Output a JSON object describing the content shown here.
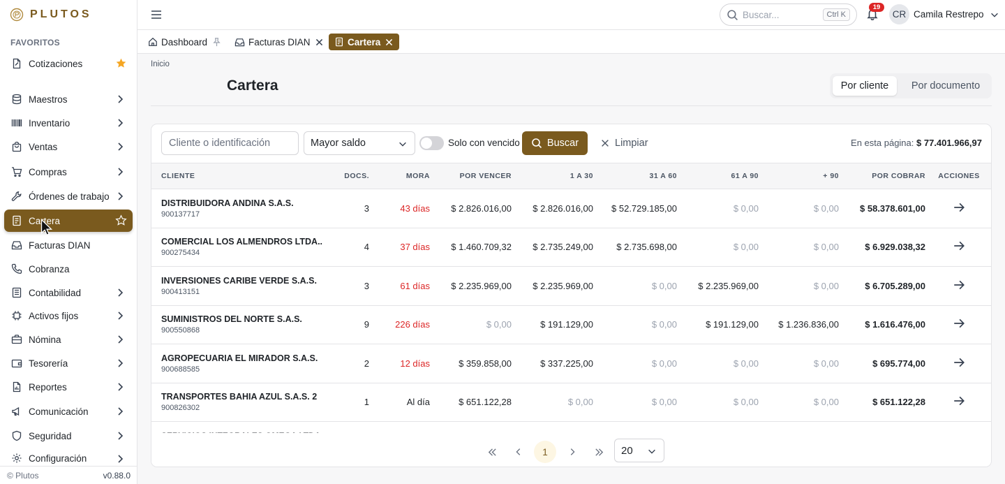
{
  "brand": {
    "name": "PLUTOS"
  },
  "sidebar": {
    "favorites_title": "FAVORITOS",
    "favorite": {
      "label": "Cotizaciones"
    },
    "items": [
      {
        "label": "Maestros"
      },
      {
        "label": "Inventario"
      },
      {
        "label": "Ventas"
      },
      {
        "label": "Compras"
      },
      {
        "label": "Órdenes de trabajo"
      },
      {
        "label": "Cartera"
      },
      {
        "label": "Facturas DIAN"
      },
      {
        "label": "Cobranza"
      },
      {
        "label": "Contabilidad"
      },
      {
        "label": "Activos fijos"
      },
      {
        "label": "Nómina"
      },
      {
        "label": "Tesorería"
      },
      {
        "label": "Reportes"
      },
      {
        "label": "Comunicación"
      },
      {
        "label": "Seguridad"
      },
      {
        "label": "Configuración"
      }
    ],
    "footer": {
      "copyright": "© Plutos",
      "version": "v0.88.0"
    }
  },
  "topbar": {
    "search_placeholder": "Buscar...",
    "search_shortcut": "Ctrl K",
    "notifications_count": "19",
    "user_initials": "CR",
    "user_name": "Camila Restrepo"
  },
  "tabs": [
    {
      "label": "Dashboard"
    },
    {
      "label": "Facturas DIAN"
    },
    {
      "label": "Cartera"
    }
  ],
  "page": {
    "breadcrumb": "Inicio",
    "title": "Cartera",
    "view_toggle": {
      "by_client": "Por cliente",
      "by_document": "Por documento"
    }
  },
  "filters": {
    "client_placeholder": "Cliente o identificación",
    "sort_value": "Mayor saldo",
    "overdue_toggle_label": "Solo con vencido",
    "overdue_toggle_on": false,
    "search_button": "Buscar",
    "clear_button": "Limpiar",
    "page_total_label": "En esta página:",
    "page_total_value": "$ 77.401.966,97"
  },
  "table": {
    "headers": {
      "client": "CLIENTE",
      "docs": "DOCS.",
      "mora": "MORA",
      "por_vencer": "POR VENCER",
      "d1_30": "1 A 30",
      "d31_60": "31 A 60",
      "d61_90": "61 A 90",
      "d90": "+ 90",
      "por_cobrar": "POR COBRAR",
      "acciones": "ACCIONES"
    },
    "rows": [
      {
        "name": "DISTRIBUIDORA ANDINA S.A.S.",
        "id": "900137717",
        "docs": "3",
        "mora": "43 días",
        "por_vencer": "$ 2.826.016,00",
        "d1_30": "$ 2.826.016,00",
        "d31_60": "$ 52.729.185,00",
        "d61_90": "$ 0,00",
        "d90": "$ 0,00",
        "por_cobrar": "$ 58.378.601,00"
      },
      {
        "name": "COMERCIAL LOS ALMENDROS LTDA..",
        "id": "900275434",
        "docs": "4",
        "mora": "37 días",
        "por_vencer": "$ 1.460.709,32",
        "d1_30": "$ 2.735.249,00",
        "d31_60": "$ 2.735.698,00",
        "d61_90": "$ 0,00",
        "d90": "$ 0,00",
        "por_cobrar": "$ 6.929.038,32"
      },
      {
        "name": "INVERSIONES CARIBE VERDE S.A.S.",
        "id": "900413151",
        "docs": "3",
        "mora": "61 días",
        "por_vencer": "$ 2.235.969,00",
        "d1_30": "$ 2.235.969,00",
        "d31_60": "$ 0,00",
        "d61_90": "$ 2.235.969,00",
        "d90": "$ 0,00",
        "por_cobrar": "$ 6.705.289,00"
      },
      {
        "name": "SUMINISTROS DEL NORTE S.A.S.",
        "id": "900550868",
        "docs": "9",
        "mora": "226 días",
        "por_vencer": "$ 0,00",
        "d1_30": "$ 191.129,00",
        "d31_60": "$ 0,00",
        "d61_90": "$ 191.129,00",
        "d90": "$ 1.236.836,00",
        "por_cobrar": "$ 1.616.476,00"
      },
      {
        "name": "AGROPECUARIA EL MIRADOR S.A.S.",
        "id": "900688585",
        "docs": "2",
        "mora": "12 días",
        "por_vencer": "$ 359.858,00",
        "d1_30": "$ 337.225,00",
        "d31_60": "$ 0,00",
        "d61_90": "$ 0,00",
        "d90": "$ 0,00",
        "por_cobrar": "$ 695.774,00"
      },
      {
        "name": "TRANSPORTES BAHIA AZUL S.A.S. 2",
        "id": "900826302",
        "docs": "1",
        "mora": "Al día",
        "por_vencer": "$ 651.122,28",
        "d1_30": "$ 0,00",
        "d31_60": "$ 0,00",
        "d61_90": "$ 0,00",
        "d90": "$ 0,00",
        "por_cobrar": "$ 651.122,28"
      }
    ],
    "partial_row_name": "SERVICIOS INTEGRALES OMEGA LTDA."
  },
  "pagination": {
    "current_page": "1",
    "page_size": "20"
  },
  "colors": {
    "accent": "#7a5a1e",
    "overdue": "#dc2626",
    "muted_zero": "#9ca3af",
    "star": "#f5a623"
  }
}
